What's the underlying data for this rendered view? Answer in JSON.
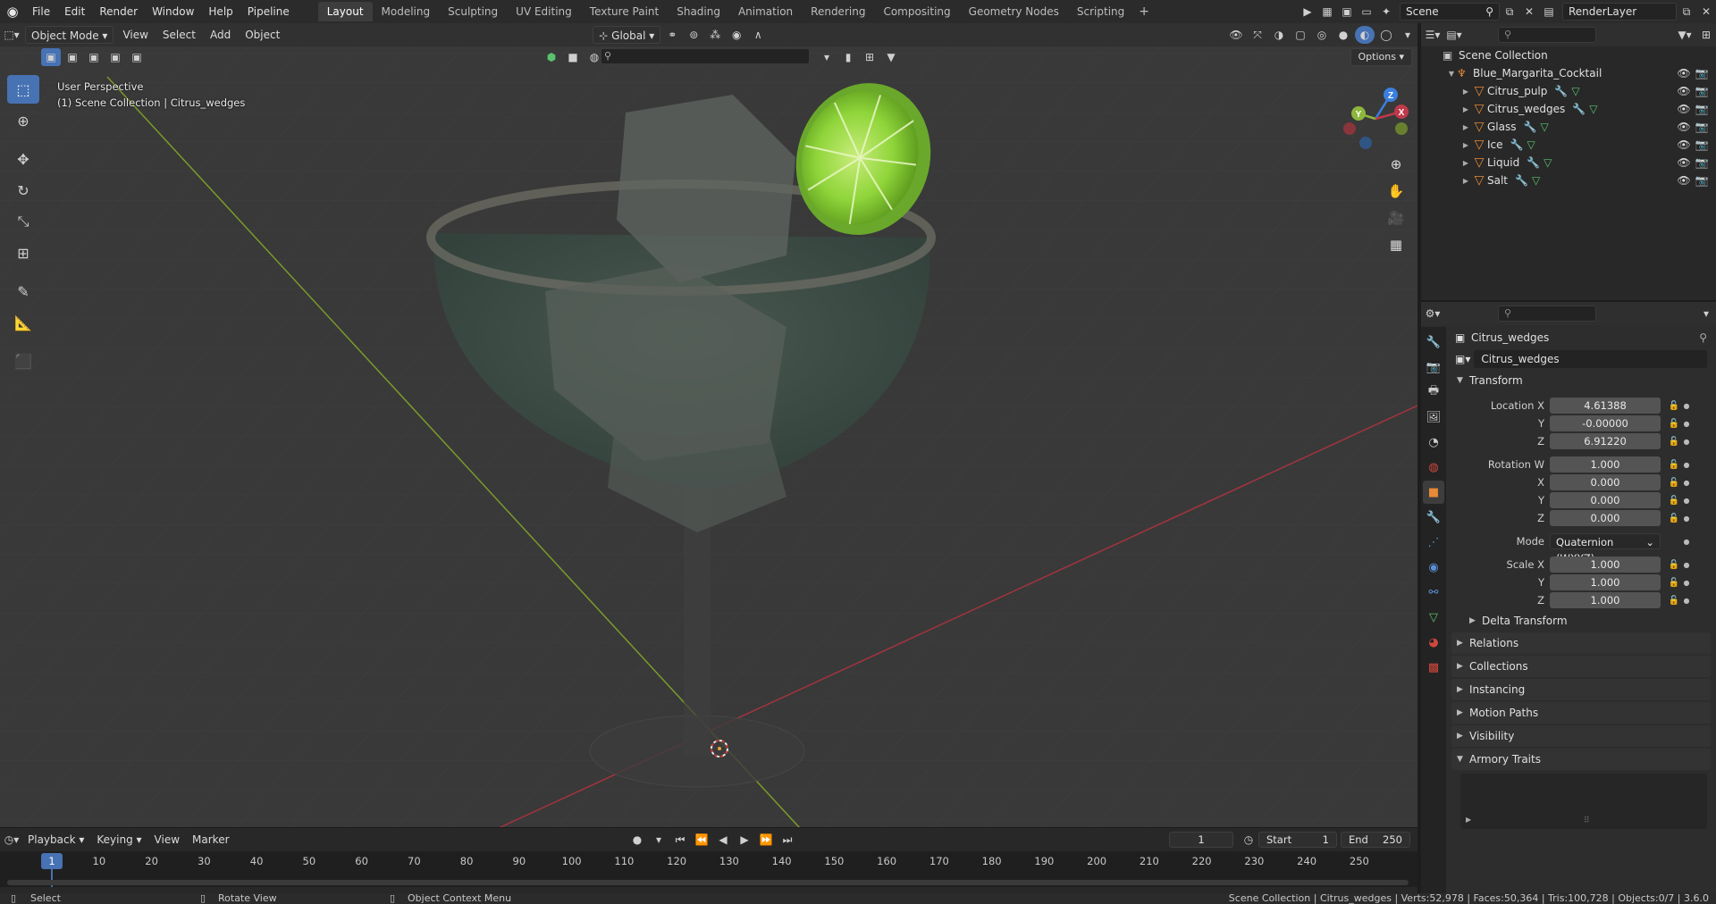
{
  "topbar": {
    "menus": [
      "File",
      "Edit",
      "Render",
      "Window",
      "Help",
      "Pipeline"
    ],
    "workspaces": [
      "Layout",
      "Modeling",
      "Sculpting",
      "UV Editing",
      "Texture Paint",
      "Shading",
      "Animation",
      "Rendering",
      "Compositing",
      "Geometry Nodes",
      "Scripting"
    ],
    "active_workspace": "Layout",
    "scene": "Scene",
    "render_layer": "RenderLayer"
  },
  "viewport": {
    "mode": "Object Mode",
    "menus": [
      "View",
      "Select",
      "Add",
      "Object"
    ],
    "orientation": "Global",
    "options_label": "Options",
    "perspective": "User Perspective",
    "context": "(1) Scene Collection | Citrus_wedges",
    "gizmo": {
      "x": "X",
      "y": "Y",
      "z": "Z"
    }
  },
  "outliner": {
    "root": "Scene Collection",
    "collection": "Blue_Margarita_Cocktail",
    "objects": [
      "Citrus_pulp",
      "Citrus_wedges",
      "Glass",
      "Ice",
      "Liquid",
      "Salt"
    ]
  },
  "properties": {
    "object_title": "Citrus_wedges",
    "object_name": "Citrus_wedges",
    "transform": {
      "title": "Transform",
      "location_label": "Location X",
      "location": [
        "4.61388",
        "-0.00000",
        "6.91220"
      ],
      "rotation_label": "Rotation W",
      "rotation": [
        "1.000",
        "0.000",
        "0.000",
        "0.000"
      ],
      "mode_label": "Mode",
      "mode": "Quaternion (WXYZ)",
      "scale_label": "Scale X",
      "scale": [
        "1.000",
        "1.000",
        "1.000"
      ],
      "axis_y": "Y",
      "axis_z": "Z",
      "axis_x": "X",
      "delta": "Delta Transform"
    },
    "panels": [
      "Relations",
      "Collections",
      "Instancing",
      "Motion Paths",
      "Visibility",
      "Armory Traits"
    ]
  },
  "timeline": {
    "menus": [
      "Playback",
      "Keying",
      "View",
      "Marker"
    ],
    "current_frame": "1",
    "start_label": "Start",
    "start": "1",
    "end_label": "End",
    "end": "250",
    "ticks": [
      "1",
      "10",
      "20",
      "30",
      "40",
      "50",
      "60",
      "70",
      "80",
      "90",
      "100",
      "110",
      "120",
      "130",
      "140",
      "150",
      "160",
      "170",
      "180",
      "190",
      "200",
      "210",
      "220",
      "230",
      "240",
      "250"
    ]
  },
  "statusbar": {
    "select": "Select",
    "rotate": "Rotate View",
    "context_menu": "Object Context Menu",
    "stats": "Scene Collection | Citrus_wedges | Verts:52,978 | Faces:50,364 | Tris:100,728 | Objects:0/7 | 3.6.0"
  },
  "colors": {
    "accent": "#4772b3",
    "object_orange": "#e78935",
    "x_axis": "#c0394a",
    "y_axis": "#8cb63c",
    "z_axis": "#3a7fe0",
    "lime": "#8fd53a"
  }
}
